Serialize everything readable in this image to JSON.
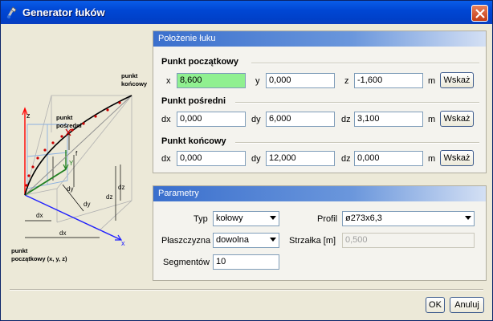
{
  "window": {
    "title": "Generator łuków"
  },
  "diagram": {
    "z": "z",
    "x": "x",
    "y": "Y",
    "f": "f",
    "end_point": [
      "punkt",
      "końcowy"
    ],
    "mid_point": [
      "punkt",
      "pośredni"
    ],
    "start_point": [
      "punkt",
      "początkowy (x, y, z)"
    ],
    "dx": "dx",
    "dy": "dy",
    "dz": "dz"
  },
  "position_panel": {
    "header": "Położenie łuku",
    "start": {
      "title": "Punkt początkowy",
      "x_label": "x",
      "x_value": "8,600",
      "y_label": "y",
      "y_value": "0,000",
      "z_label": "z",
      "z_value": "-1,600",
      "unit": "m",
      "show_label": "Wskaż"
    },
    "mid": {
      "title": "Punkt pośredni",
      "dx_label": "dx",
      "dx_value": "0,000",
      "dy_label": "dy",
      "dy_value": "6,000",
      "dz_label": "dz",
      "dz_value": "3,100",
      "unit": "m",
      "show_label": "Wskaż"
    },
    "end": {
      "title": "Punkt końcowy",
      "dx_label": "dx",
      "dx_value": "0,000",
      "dy_label": "dy",
      "dy_value": "12,000",
      "dz_label": "dz",
      "dz_value": "0,000",
      "unit": "m",
      "show_label": "Wskaż"
    }
  },
  "params_panel": {
    "header": "Parametry",
    "type_label": "Typ",
    "type_value": "kołowy",
    "plane_label": "Płaszczyzna",
    "plane_value": "dowolna",
    "segments_label": "Segmentów",
    "segments_value": "10",
    "profile_label": "Profil",
    "profile_value": "ø273x6,3",
    "sag_label": "Strzałka [m]",
    "sag_value": "0,500"
  },
  "footer": {
    "ok_label": "OK",
    "cancel_label": "Anuluj"
  },
  "colors": {
    "titlebar": "#0a4fd8",
    "active_field": "#90f090",
    "panel_header": "#3a6fcd"
  }
}
